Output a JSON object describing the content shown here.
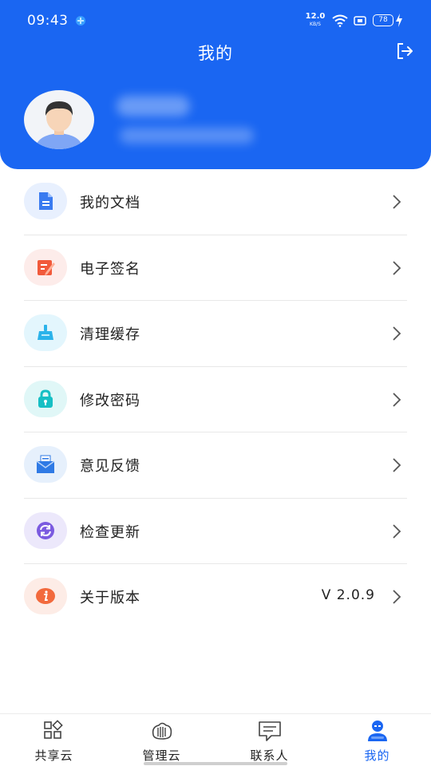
{
  "status_bar": {
    "time": "09:43",
    "network_speed_value": "12.0",
    "network_speed_unit": "KB/S",
    "battery": "78"
  },
  "header": {
    "title": "我的"
  },
  "menu": {
    "items": [
      {
        "label": "我的文档",
        "icon": "document-icon",
        "icon_bg": "#e8f0fe",
        "icon_color": "#3a7bf0"
      },
      {
        "label": "电子签名",
        "icon": "signature-icon",
        "icon_bg": "#fdecea",
        "icon_color": "#f15a3b"
      },
      {
        "label": "清理缓存",
        "icon": "broom-icon",
        "icon_bg": "#e3f6fd",
        "icon_color": "#2bb3ea"
      },
      {
        "label": "修改密码",
        "icon": "lock-icon",
        "icon_bg": "#e0f7f7",
        "icon_color": "#16bfc4"
      },
      {
        "label": "意见反馈",
        "icon": "mail-icon",
        "icon_bg": "#e6f0fc",
        "icon_color": "#2f7ae5"
      },
      {
        "label": "检查更新",
        "icon": "refresh-icon",
        "icon_bg": "#ece8fb",
        "icon_color": "#7b5be0"
      },
      {
        "label": "关于版本",
        "icon": "info-icon",
        "icon_bg": "#fdece6",
        "icon_color": "#f26a3d",
        "value": "V 2.0.9"
      }
    ]
  },
  "bottom_nav": {
    "items": [
      {
        "label": "共享云",
        "icon": "grid-apps-icon"
      },
      {
        "label": "管理云",
        "icon": "cloud-server-icon"
      },
      {
        "label": "联系人",
        "icon": "chat-icon"
      },
      {
        "label": "我的",
        "icon": "person-icon",
        "active": true
      }
    ]
  },
  "colors": {
    "primary": "#1a66f2",
    "text": "#222222",
    "divider": "#e8e8e8"
  }
}
